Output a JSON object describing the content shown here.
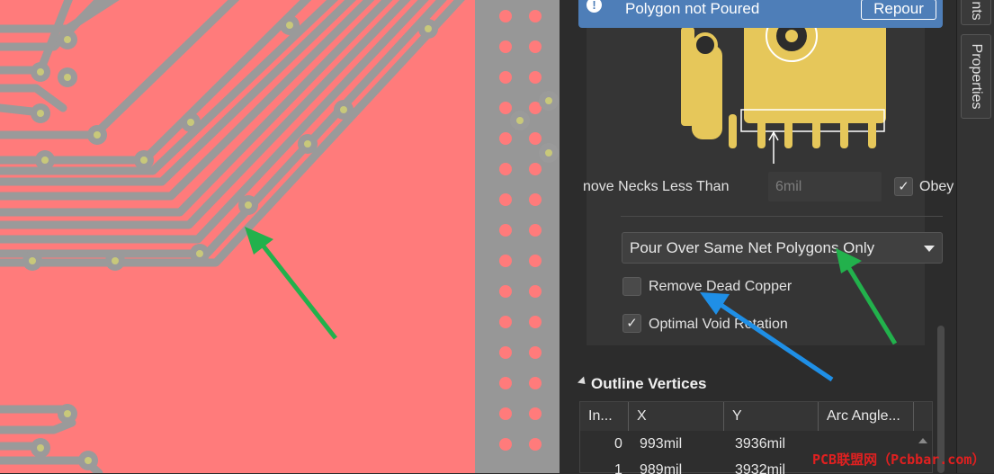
{
  "notification": {
    "message": "Polygon not Poured",
    "repour_label": "Repour",
    "icon": "exclamation-icon"
  },
  "options": {
    "necks_label": "nove Necks Less Than",
    "necks_value": "6mil",
    "obey_label": "Obey",
    "obey_checked": true,
    "pour_mode": "Pour Over Same Net Polygons Only",
    "remove_dead_copper_label": "Remove Dead Copper",
    "remove_dead_copper_checked": false,
    "optimal_void_label": "Optimal Void Rotation",
    "optimal_void_checked": true
  },
  "outline": {
    "title": "Outline Vertices",
    "columns": [
      "In...",
      "X",
      "Y",
      "Arc Angle..."
    ],
    "rows": [
      {
        "index": "0",
        "x": "993mil",
        "y": "3936mil"
      },
      {
        "index": "1",
        "x": "989mil",
        "y": "3932mil"
      }
    ]
  },
  "side_tabs": {
    "top": "nts",
    "properties": "Properties"
  },
  "watermark": "PCB联盟网（Pcbbar.com）",
  "colors": {
    "copper_pour": "#ff7b7b",
    "trace": "#9a9a9a",
    "pad": "#e6c75a",
    "notice": "#4e7eb8",
    "arrow_green": "#22b14c",
    "arrow_blue": "#1f8fe6"
  }
}
